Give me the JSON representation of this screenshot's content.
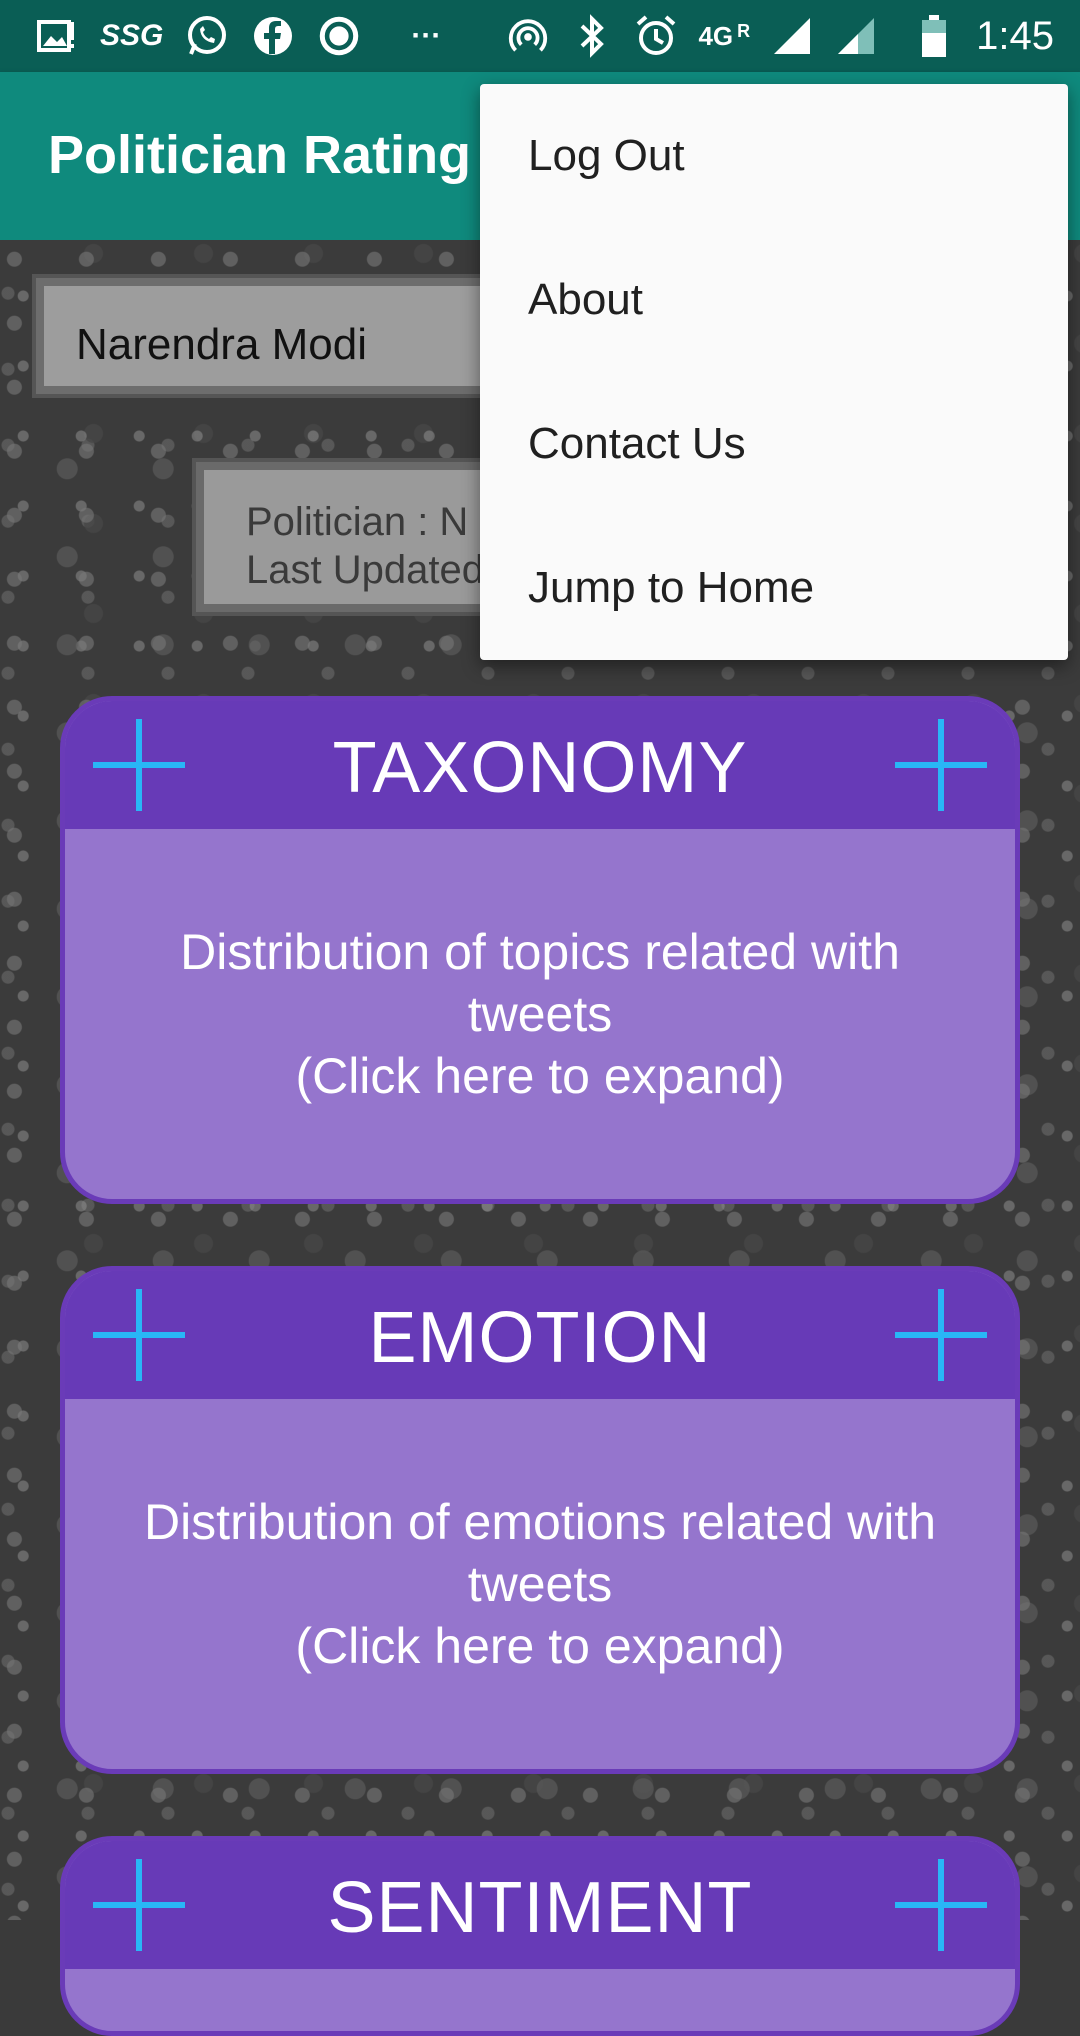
{
  "status_bar": {
    "left_icons": [
      "gallery-notification-icon",
      "ssg-icon",
      "whatsapp-icon",
      "facebook-icon",
      "circle-app-icon",
      "more-notifications-icon"
    ],
    "ssg_text": "SSG",
    "dots_text": "···",
    "network_text": "4G",
    "roaming_text": "R",
    "time": "1:45"
  },
  "app_bar": {
    "title": "Politician Rating"
  },
  "selector": {
    "value": "Narendra Modi"
  },
  "info_box": {
    "line1": "Politician : N",
    "line2": "Last Updated"
  },
  "menu": {
    "items": [
      {
        "label": "Log Out"
      },
      {
        "label": "About"
      },
      {
        "label": "Contact Us"
      },
      {
        "label": "Jump to Home"
      }
    ]
  },
  "cards": [
    {
      "title": "TAXONOMY",
      "desc_line1": "Distribution of topics related with",
      "desc_line2": "tweets",
      "desc_line3": "(Click here to expand)"
    },
    {
      "title": "EMOTION",
      "desc_line1": "Distribution of emotions related with",
      "desc_line2": "tweets",
      "desc_line3": "(Click here to expand)"
    },
    {
      "title": "SENTIMENT"
    }
  ],
  "colors": {
    "status_bar": "#0a5e55",
    "app_bar": "#0f8a7d",
    "card_header": "#673ab7",
    "card_body": "#9575cd",
    "plus_icon": "#29b6f6"
  }
}
